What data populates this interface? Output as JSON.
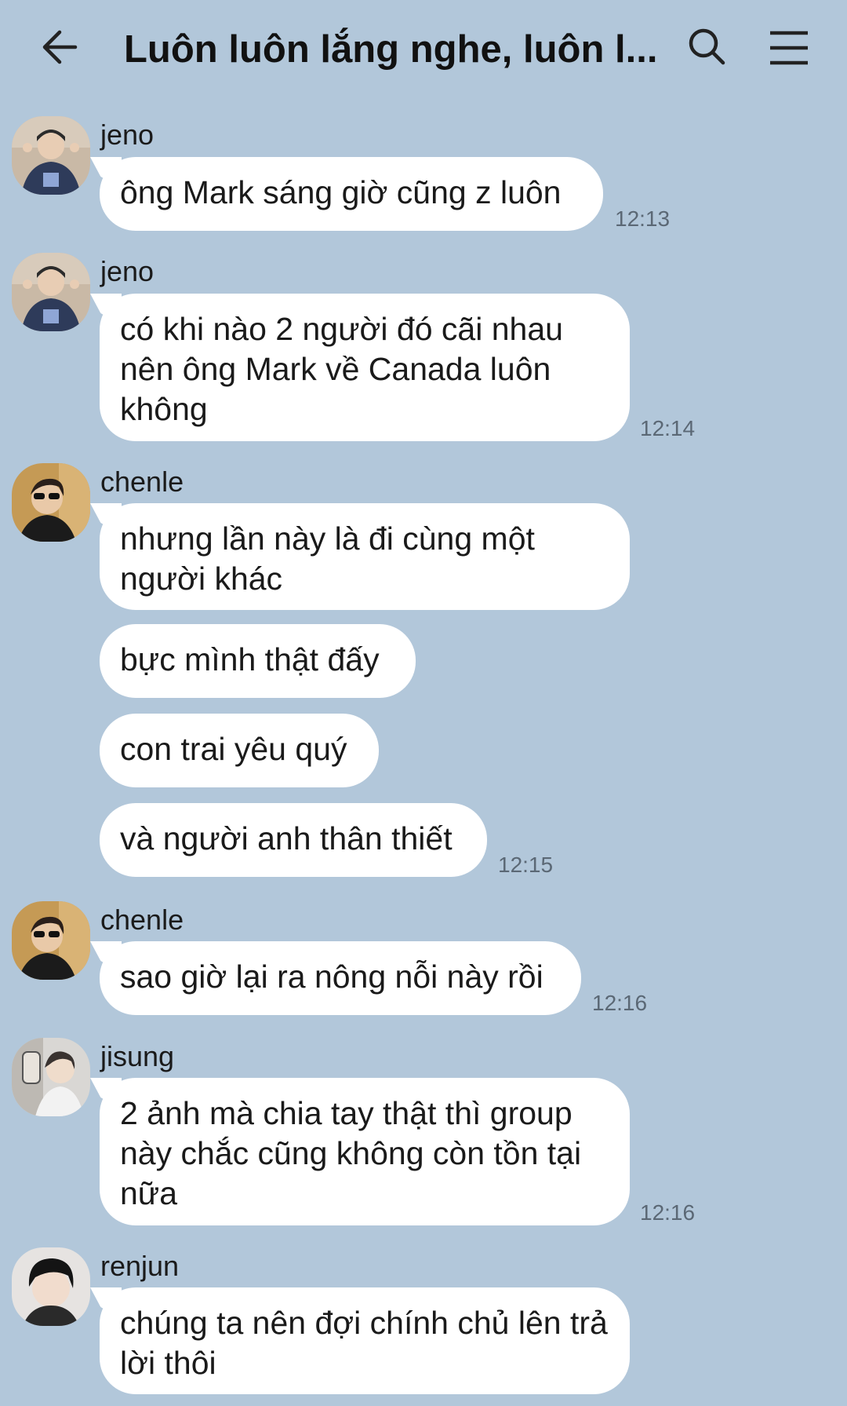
{
  "header": {
    "title": "Luôn luôn lắng nghe, luôn l...",
    "back_icon": "arrow-left-icon",
    "search_icon": "search-icon",
    "menu_icon": "hamburger-menu-icon"
  },
  "messages": [
    {
      "sender": "jeno",
      "texts": [
        "ông Mark sáng giờ cũng z luôn"
      ],
      "time": "12:13"
    },
    {
      "sender": "jeno",
      "texts": [
        "có khi nào 2 người đó cãi nhau nên ông Mark về Canada luôn không"
      ],
      "time": "12:14"
    },
    {
      "sender": "chenle",
      "texts": [
        "nhưng lần này là đi cùng một người khác",
        "bực mình thật đấy",
        "con trai yêu quý",
        "và người anh thân thiết"
      ],
      "time": "12:15"
    },
    {
      "sender": "chenle",
      "texts": [
        "sao giờ lại ra nông nỗi này rồi"
      ],
      "time": "12:16"
    },
    {
      "sender": "jisung",
      "texts": [
        "2 ảnh mà chia tay thật thì group này chắc cũng không còn tồn tại nữa"
      ],
      "time": "12:16"
    },
    {
      "sender": "renjun",
      "texts": [
        "chúng ta nên đợi chính chủ lên trả lời thôi"
      ],
      "time": ""
    }
  ]
}
